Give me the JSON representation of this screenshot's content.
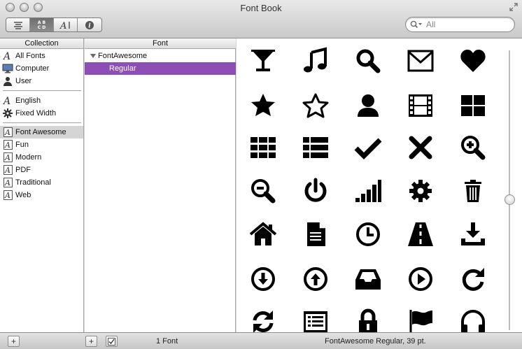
{
  "window": {
    "title": "Font Book"
  },
  "search": {
    "placeholder": "All"
  },
  "toolbar": {
    "buttons": [
      "list-view",
      "sample-view",
      "custom-view",
      "info"
    ]
  },
  "columns": {
    "collection": "Collection",
    "font": "Font"
  },
  "collections": {
    "library": [
      {
        "label": "All Fonts",
        "icon": "script-a-icon"
      },
      {
        "label": "Computer",
        "icon": "monitor-icon"
      },
      {
        "label": "User",
        "icon": "person-icon"
      }
    ],
    "smart": [
      {
        "label": "English",
        "icon": "script-a-icon"
      },
      {
        "label": "Fixed Width",
        "icon": "gear-icon"
      }
    ],
    "custom": [
      {
        "label": "Font Awesome",
        "icon": "collection-icon",
        "selected": true
      },
      {
        "label": "Fun",
        "icon": "collection-icon"
      },
      {
        "label": "Modern",
        "icon": "collection-icon"
      },
      {
        "label": "PDF",
        "icon": "collection-icon"
      },
      {
        "label": "Traditional",
        "icon": "collection-icon"
      },
      {
        "label": "Web",
        "icon": "collection-icon"
      }
    ]
  },
  "fonts": {
    "family": "FontAwesome",
    "faces": [
      "Regular"
    ],
    "selected_face": "Regular"
  },
  "preview": {
    "size_fraction": 0.52,
    "glyphs": [
      "glass-icon",
      "music-icon",
      "search-icon",
      "envelope-icon",
      "heart-icon",
      "star-icon",
      "star-empty-icon",
      "user-icon",
      "film-icon",
      "th-large-icon",
      "th-icon",
      "th-list-icon",
      "ok-icon",
      "remove-icon",
      "zoom-in-icon",
      "zoom-out-icon",
      "off-icon",
      "signal-icon",
      "cog-icon",
      "trash-icon",
      "home-icon",
      "file-icon",
      "time-icon",
      "road-icon",
      "download-alt-icon",
      "download-icon",
      "upload-icon",
      "inbox-icon",
      "play-circle-icon",
      "repeat-icon",
      "refresh-icon",
      "list-alt-icon",
      "lock-icon",
      "flag-icon",
      "headphones-icon"
    ]
  },
  "status": {
    "font_count": "1 Font",
    "font_info": "FontAwesome Regular, 39 pt."
  },
  "colors": {
    "selection": "#8d4fb6",
    "collection_selected": "#d5d5d5"
  }
}
